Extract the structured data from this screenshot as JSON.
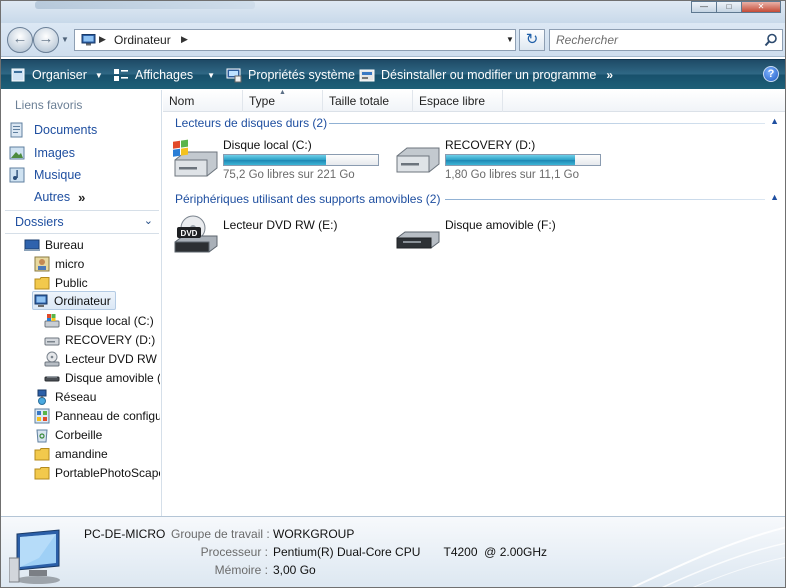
{
  "address": {
    "location": "Ordinateur"
  },
  "search": {
    "placeholder": "Rechercher"
  },
  "toolbar": {
    "organize": "Organiser",
    "views": "Affichages",
    "system_properties": "Propriétés système",
    "uninstall": "Désinstaller ou modifier un programme",
    "help": "?"
  },
  "favorites": {
    "header": "Liens favoris",
    "items": [
      {
        "label": "Documents",
        "icon": "documents-icon"
      },
      {
        "label": "Images",
        "icon": "pictures-icon"
      },
      {
        "label": "Musique",
        "icon": "music-icon"
      }
    ],
    "more": "Autres",
    "more_arrows": "»"
  },
  "folders": {
    "header": "Dossiers",
    "tree": [
      {
        "label": "Bureau",
        "icon": "desktop-icon"
      },
      {
        "label": "micro",
        "icon": "user-folder-icon"
      },
      {
        "label": "Public",
        "icon": "folder-icon"
      },
      {
        "label": "Ordinateur",
        "icon": "computer-icon",
        "selected": true
      },
      {
        "label": "Disque local (C:)",
        "icon": "windows-drive-icon"
      },
      {
        "label": "RECOVERY (D:)",
        "icon": "drive-icon"
      },
      {
        "label": "Lecteur DVD RW (",
        "icon": "dvd-icon"
      },
      {
        "label": "Disque amovible (",
        "icon": "removable-drive-icon"
      },
      {
        "label": "Réseau",
        "icon": "network-icon"
      },
      {
        "label": "Panneau de configu",
        "icon": "control-panel-icon"
      },
      {
        "label": "Corbeille",
        "icon": "recycle-bin-icon"
      },
      {
        "label": "amandine",
        "icon": "folder-icon"
      },
      {
        "label": "PortablePhotoScape",
        "icon": "folder-icon"
      }
    ]
  },
  "columns": [
    "Nom",
    "Type",
    "Taille totale",
    "Espace libre"
  ],
  "groups": {
    "hard_drives": {
      "title": "Lecteurs de disques durs (2)",
      "drives": [
        {
          "name": "Disque local (C:)",
          "free_text": "75,2 Go libres sur 221 Go",
          "used_fraction": 0.66,
          "icon": "windows-drive-icon"
        },
        {
          "name": "RECOVERY (D:)",
          "free_text": "1,80 Go libres sur 11,1 Go",
          "used_fraction": 0.84,
          "icon": "drive-icon"
        }
      ]
    },
    "removable": {
      "title": "Périphériques utilisant des supports amovibles (2)",
      "drives": [
        {
          "name": "Lecteur DVD RW (E:)",
          "icon": "dvd-icon",
          "badge": "DVD"
        },
        {
          "name": "Disque amovible (F:)",
          "icon": "removable-drive-icon"
        }
      ]
    }
  },
  "details": {
    "computer_name": "PC-DE-MICRO",
    "workgroup_label": "Groupe de travail :",
    "workgroup": "WORKGROUP",
    "processor_label": "Processeur :",
    "processor": "Pentium(R) Dual-Core CPU       T4200  @ 2.00GHz",
    "memory_label": "Mémoire :",
    "memory": "3,00 Go"
  },
  "colors": {
    "toolbar": "#2f6885",
    "link": "#1f4fa0",
    "usage_fill": "#2a9fc6"
  }
}
